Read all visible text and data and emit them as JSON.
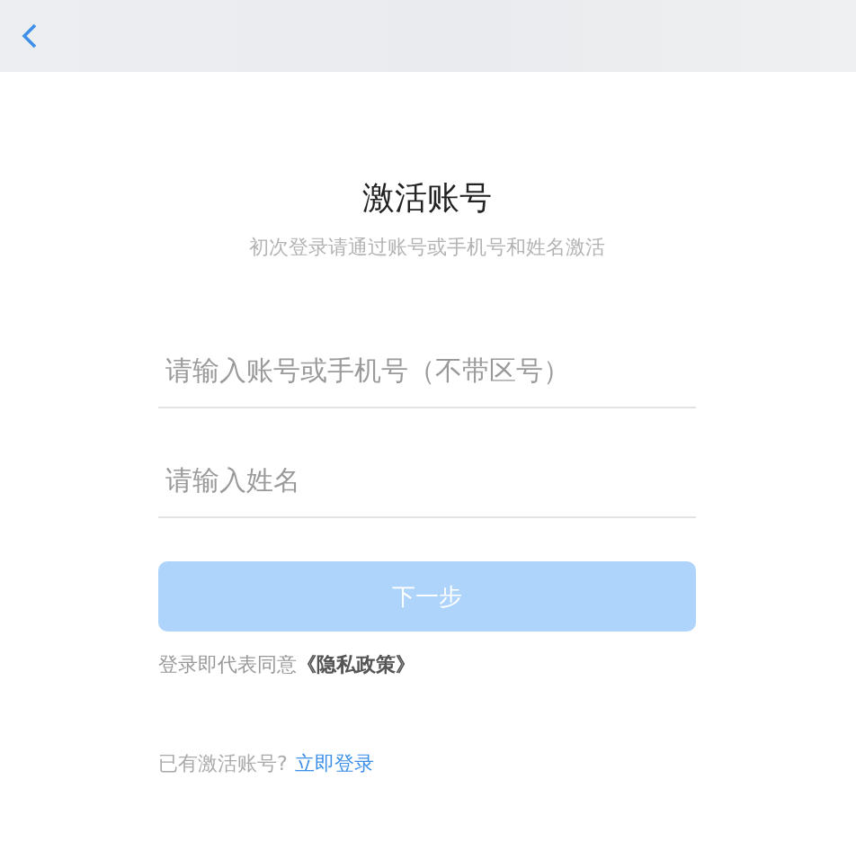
{
  "title": "激活账号",
  "subtitle": "初次登录请通过账号或手机号和姓名激活",
  "fields": [
    {
      "placeholder": "请输入账号或手机号（不带区号）"
    },
    {
      "placeholder": "请输入姓名"
    }
  ],
  "next_button": {
    "label": "下一步",
    "disabled": true
  },
  "agreement": "登录即代表同意**《隐私政策》**",
  "login_prompt": {
    "text": "已有激活账号?",
    "link": "立即登录"
  }
}
